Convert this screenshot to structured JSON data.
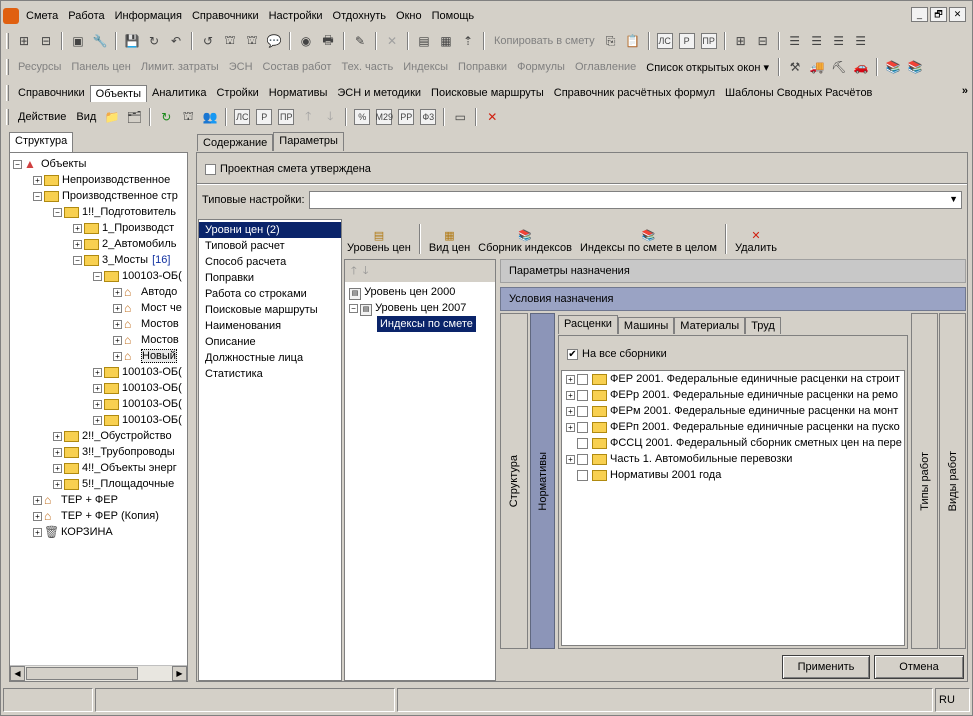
{
  "menu": [
    "Смета",
    "Работа",
    "Информация",
    "Справочники",
    "Настройки",
    "Отдохнуть",
    "Окно",
    "Помощь"
  ],
  "window_controls": [
    "_",
    "🗗",
    "✕"
  ],
  "toolbar2": {
    "copy_label": "Копировать в смету"
  },
  "toolbar3": [
    "Ресурсы",
    "Панель цен",
    "Лимит. затраты",
    "ЭСН",
    "Состав работ",
    "Тех. часть",
    "Индексы",
    "Поправки",
    "Формулы",
    "Оглавление",
    "Список открытых окон ▾"
  ],
  "nav_tabs": [
    "Справочники",
    "Объекты",
    "Аналитика",
    "Стройки",
    "Нормативы",
    "ЭСН и методики",
    "Поисковые маршруты",
    "Справочник расчётных формул",
    "Шаблоны Сводных Расчётов"
  ],
  "action_bar": {
    "action": "Действие",
    "view": "Вид"
  },
  "left_tab": "Структура",
  "tree": [
    {
      "lvl": 0,
      "pm": "−",
      "icon": "objects",
      "text": "Объекты"
    },
    {
      "lvl": 1,
      "pm": "+",
      "icon": "folder",
      "text": "Непроизводственное"
    },
    {
      "lvl": 1,
      "pm": "−",
      "icon": "folder",
      "text": "Производственное стр"
    },
    {
      "lvl": 2,
      "pm": "−",
      "icon": "folder",
      "text": "1!!_Подготовитель"
    },
    {
      "lvl": 3,
      "pm": "+",
      "icon": "folder",
      "text": "1_Производст"
    },
    {
      "lvl": 3,
      "pm": "+",
      "icon": "folder",
      "text": "2_Автомобиль"
    },
    {
      "lvl": 3,
      "pm": "−",
      "icon": "folder",
      "text": "3_Мосты",
      "count": "[16]"
    },
    {
      "lvl": 4,
      "pm": "−",
      "icon": "folder",
      "text": "100103-ОБ("
    },
    {
      "lvl": 5,
      "pm": "+",
      "icon": "house",
      "text": "Автодо"
    },
    {
      "lvl": 5,
      "pm": "+",
      "icon": "house",
      "text": "Мост че"
    },
    {
      "lvl": 5,
      "pm": "+",
      "icon": "house",
      "text": "Мостов"
    },
    {
      "lvl": 5,
      "pm": "+",
      "icon": "house",
      "text": "Мостов"
    },
    {
      "lvl": 5,
      "pm": "+",
      "icon": "house",
      "text": "Новый",
      "selected": true
    },
    {
      "lvl": 4,
      "pm": "+",
      "icon": "folder",
      "text": "100103-ОБ("
    },
    {
      "lvl": 4,
      "pm": "+",
      "icon": "folder",
      "text": "100103-ОБ("
    },
    {
      "lvl": 4,
      "pm": "+",
      "icon": "folder",
      "text": "100103-ОБ("
    },
    {
      "lvl": 4,
      "pm": "+",
      "icon": "folder",
      "text": "100103-ОБ("
    },
    {
      "lvl": 2,
      "pm": "+",
      "icon": "folder",
      "text": "2!!_Обустройство"
    },
    {
      "lvl": 2,
      "pm": "+",
      "icon": "folder",
      "text": "3!!_Трубопроводы"
    },
    {
      "lvl": 2,
      "pm": "+",
      "icon": "folder",
      "text": "4!!_Объекты энерг"
    },
    {
      "lvl": 2,
      "pm": "+",
      "icon": "folder",
      "text": "5!!_Площадочные"
    },
    {
      "lvl": 1,
      "pm": "+",
      "icon": "house",
      "text": "ТЕР + ФЕР"
    },
    {
      "lvl": 1,
      "pm": "+",
      "icon": "house",
      "text": "ТЕР + ФЕР (Копия)"
    },
    {
      "lvl": 1,
      "pm": "+",
      "icon": "trash",
      "text": "КОРЗИНА"
    }
  ],
  "right_tabs": [
    "Содержание",
    "Параметры"
  ],
  "approved_label": "Проектная смета утверждена",
  "typical_settings_label": "Типовые настройки:",
  "settings_list": [
    "Уровни цен (2)",
    "Типовой расчет",
    "Способ расчета",
    "Поправки",
    "Работа со строками",
    "Поисковые маршруты",
    "Наименования",
    "Описание",
    "Должностные лица",
    "Статистика"
  ],
  "price_toolbar": [
    "Уровень цен",
    "Вид цен",
    "Сборник индексов",
    "Индексы по смете в целом",
    "Удалить"
  ],
  "levels_tree": [
    "Уровень цен 2000",
    "Уровень цен 2007",
    "Индексы по смете"
  ],
  "params_header": "Параметры назначения",
  "conditions_header": "Условия назначения",
  "vert_tabs_left": [
    "Структура",
    "Нормативы"
  ],
  "vert_tabs_right": [
    "Типы работ",
    "Виды работ"
  ],
  "inner_tabs": [
    "Расценки",
    "Машины",
    "Материалы",
    "Труд"
  ],
  "all_collections_label": "На все сборники",
  "collections": [
    {
      "pm": "+",
      "text": "ФЕР 2001. Федеральные единичные расценки на строит"
    },
    {
      "pm": "+",
      "text": "ФЕРр 2001. Федеральные единичные расценки на ремо"
    },
    {
      "pm": "+",
      "text": "ФЕРм 2001. Федеральные единичные расценки на монт"
    },
    {
      "pm": "+",
      "text": "ФЕРп 2001. Федеральные единичные расценки на пуско"
    },
    {
      "pm": "",
      "text": "ФССЦ 2001. Федеральный сборник сметных цен на пере"
    },
    {
      "pm": "+",
      "text": "Часть 1. Автомобильные перевозки"
    },
    {
      "pm": "",
      "text": "Нормативы 2001 года"
    }
  ],
  "apply_label": "Применить",
  "cancel_label": "Отмена",
  "status_lang": "RU"
}
